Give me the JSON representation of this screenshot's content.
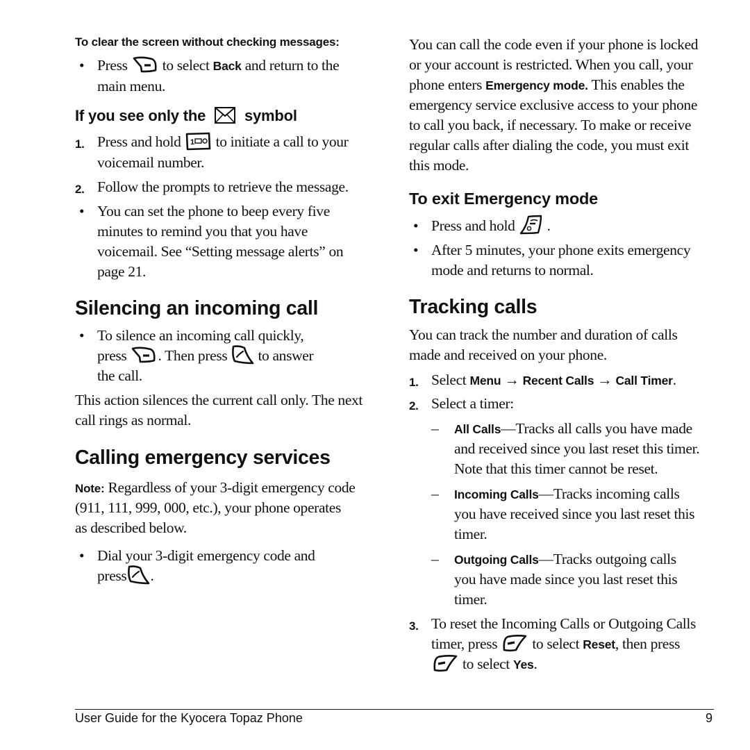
{
  "left_column": {
    "clear_screen": {
      "heading": "To clear the screen without checking messages:",
      "bullet": {
        "pre": "Press",
        "icon": "back-softkey-icon",
        "mid": "to select",
        "bold": "Back",
        "post_line1": "and return to the",
        "line2": "main menu."
      }
    },
    "only_symbol": {
      "heading_pre": "If you see only the",
      "heading_icon": "envelope-icon",
      "heading_post": "symbol",
      "step1_num": "1.",
      "step1_pre": "Press and hold",
      "step1_icon": "voicemail-key-icon",
      "step1_post": "to initiate a call to your",
      "step1_line2": "voicemail number.",
      "step2_num": "2.",
      "step2_text": "Follow the prompts to retrieve the message.",
      "bullet_lines": [
        "You can set the phone to beep every five",
        "minutes to remind you that you have",
        "voicemail. See “Setting message alerts” on",
        "page 21."
      ]
    },
    "silencing": {
      "title": "Silencing an incoming call",
      "bullet_line1": "To silence an incoming call quickly,",
      "line2_pre": "press",
      "line2_icon1": "back-softkey-icon",
      "line2_mid": ". Then press",
      "line2_icon2": "send-key-icon",
      "line2_post": "to answer",
      "line3": "the call.",
      "para_lines": [
        "This action silences the current call only. The next",
        "call rings as normal."
      ]
    },
    "emergency": {
      "title": "Calling emergency services",
      "note_label": "Note:",
      "note_line1": "Regardless of your 3-digit emergency code",
      "note_lines": [
        "(911, 111, 999, 000, etc.), your phone operates",
        "as described below."
      ],
      "bullet_line1": "Dial  your 3-digit emergency code and",
      "bullet_line2_pre": "press",
      "bullet_line2_icon": "send-key-icon",
      "bullet_line2_post": "."
    }
  },
  "right_column": {
    "intro": {
      "line1": "You can call the code even if your phone is locked",
      "line2": "or your account is restricted. When you call, your",
      "line3_pre": "phone enters",
      "line3_bold": "Emergency mode.",
      "line3_post": "This enables the",
      "lines_rest": [
        "emergency service exclusive access to your phone",
        "to call you back, if necessary. To make or receive",
        "regular calls after dialing the code, you must exit",
        "this mode."
      ]
    },
    "exit_mode": {
      "title": "To exit Emergency mode",
      "bullet1_pre": "Press and hold",
      "bullet1_icon": "end-key-icon",
      "bullet1_post": ".",
      "bullet2_lines": [
        "After 5 minutes, your phone exits emergency",
        "mode and returns to normal."
      ]
    },
    "tracking": {
      "title": "Tracking calls",
      "para_lines": [
        "You can track the number and duration of calls",
        "made and received on your phone."
      ],
      "step1_num": "1.",
      "step1_pre": "Select",
      "step1_menu": "Menu",
      "arrow": "→",
      "step1_recent": "Recent Calls",
      "step1_timer": "Call Timer",
      "step1_end": ".",
      "step2_num": "2.",
      "step2_text": "Select a timer:",
      "dash": "–",
      "timers": [
        {
          "label": "All Calls",
          "line1_rest": "—Tracks all calls you have made",
          "lines": [
            "and received since you last reset this timer.",
            "Note that this timer cannot be reset."
          ]
        },
        {
          "label": "Incoming Calls",
          "line1_rest": "—Tracks incoming calls",
          "lines": [
            "you have received since you last reset this",
            "timer."
          ]
        },
        {
          "label": "Outgoing Calls",
          "line1_rest": "—Tracks outgoing calls",
          "lines": [
            "you have made since you last reset this",
            "timer."
          ]
        }
      ],
      "step3_num": "3.",
      "step3_line1": "To reset the Incoming Calls or Outgoing Calls",
      "step3_line2_pre": "timer, press",
      "step3_icon": "right-softkey-icon",
      "step3_line2_mid": "to select",
      "step3_reset": "Reset",
      "step3_line2_post": ", then press",
      "step3_line3_post": "to select",
      "step3_yes": "Yes",
      "step3_end": "."
    }
  },
  "footer": {
    "title": "User Guide for the Kyocera Topaz Phone",
    "page_number": "9"
  }
}
